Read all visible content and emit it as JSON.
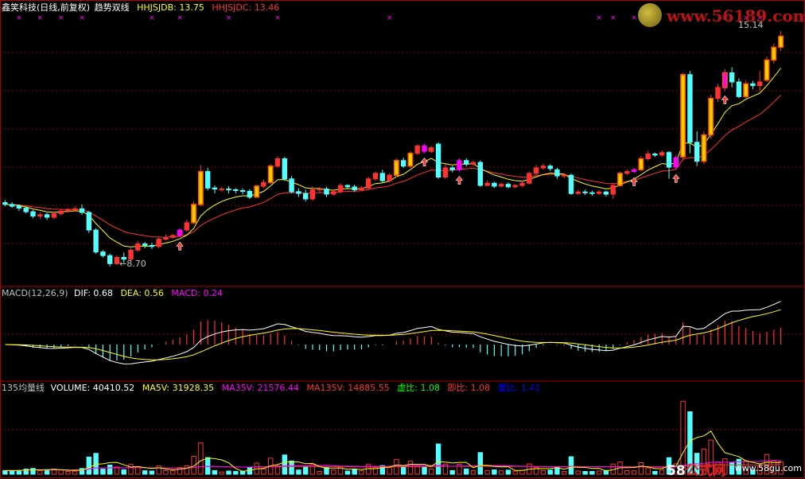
{
  "price_panel": {
    "title": "鑫笑科技(日线,前复权)",
    "indicator": "趋势双线",
    "hhjsjdb_label": "HHJSJDB: 13.75",
    "hhjsjdc_label": "HHJSJDC: 13.46",
    "high_label": "15.14",
    "low_label": "←8.70"
  },
  "macd_panel": {
    "title": "MACD(12,26,9)",
    "dif_label": "DIF: 0.68",
    "dea_label": "DEA: 0.56",
    "macd_label": "MACD: 0.24"
  },
  "volume_panel": {
    "title": "135均量线",
    "volume_label": "VOLUME: 40410.52",
    "ma5v_label": "MA5V: 31928.35",
    "ma35v_label": "MA35V: 21576.44",
    "ma135v_label": "MA135V: 14885.55",
    "xu_label": "虚比: 1.08",
    "ji_label": "即比: 1.08",
    "liang_label": "量比: 1.41"
  },
  "watermarks": {
    "top_site": "www.56189.com",
    "bottom_brand_num": "58",
    "bottom_brand_cn": "公式网",
    "bottom_url": "www.58gu.com"
  },
  "colors": {
    "up": "#ff3232",
    "down": "#54ffff",
    "up_fill": "#000000",
    "buy_mark": "#ff00ff",
    "ma_fast": "#ffff00",
    "ma_slow": "#ff3232",
    "grid": "#8b0000",
    "dif": "#ffffff",
    "dea": "#ffff00",
    "vol_ma5": "#ffff00",
    "vol_ma35": "#ff00ff",
    "vol_ma135": "#ff3232"
  },
  "chart_data": {
    "type": "candlestick",
    "price_range": [
      8.2,
      15.6
    ],
    "candles": [
      [
        10.45,
        10.4,
        10.52,
        10.35
      ],
      [
        10.4,
        10.35,
        10.46,
        10.3
      ],
      [
        10.36,
        10.3,
        10.4,
        10.22
      ],
      [
        10.3,
        10.2,
        10.35,
        10.15
      ],
      [
        10.2,
        10.08,
        10.25,
        10.02
      ],
      [
        10.08,
        10.12,
        10.18,
        10.0
      ],
      [
        10.12,
        10.05,
        10.16,
        9.98
      ],
      [
        10.05,
        10.15,
        10.2,
        10.0
      ],
      [
        10.15,
        10.22,
        10.28,
        10.1
      ],
      [
        10.22,
        10.25,
        10.3,
        10.18
      ],
      [
        10.25,
        10.28,
        10.35,
        10.2
      ],
      [
        10.28,
        10.18,
        10.4,
        10.12
      ],
      [
        10.18,
        9.7,
        10.22,
        9.62
      ],
      [
        9.7,
        9.1,
        9.75,
        9.05
      ],
      [
        9.1,
        9.0,
        9.15,
        8.95
      ],
      [
        9.0,
        8.78,
        9.05,
        8.7
      ],
      [
        8.78,
        8.95,
        9.0,
        8.74
      ],
      [
        8.95,
        8.9,
        9.08,
        8.8
      ],
      [
        8.9,
        9.15,
        9.2,
        8.85
      ],
      [
        9.15,
        9.32,
        9.4,
        9.1
      ],
      [
        9.32,
        9.28,
        9.38,
        9.2
      ],
      [
        9.28,
        9.25,
        9.35,
        9.18
      ],
      [
        9.25,
        9.45,
        9.5,
        9.2
      ],
      [
        9.45,
        9.5,
        9.58,
        9.42
      ],
      [
        9.5,
        9.55,
        9.6,
        9.46
      ],
      [
        9.55,
        9.7,
        9.75,
        9.5
      ],
      [
        9.7,
        9.9,
        9.98,
        9.66
      ],
      [
        9.9,
        10.4,
        10.48,
        9.85
      ],
      [
        10.4,
        11.3,
        11.48,
        10.35
      ],
      [
        11.3,
        10.85,
        11.4,
        10.78
      ],
      [
        10.85,
        10.82,
        10.92,
        10.7
      ],
      [
        10.82,
        10.82,
        10.88,
        10.75
      ],
      [
        10.82,
        10.8,
        10.9,
        10.7
      ],
      [
        10.8,
        10.78,
        10.85,
        10.7
      ],
      [
        10.78,
        10.76,
        10.84,
        10.68
      ],
      [
        10.76,
        10.6,
        10.82,
        10.55
      ],
      [
        10.6,
        10.9,
        10.95,
        10.58
      ],
      [
        10.9,
        11.0,
        11.08,
        10.85
      ],
      [
        11.0,
        11.45,
        11.5,
        10.96
      ],
      [
        11.45,
        11.65,
        11.72,
        11.4
      ],
      [
        11.65,
        11.1,
        11.7,
        11.05
      ],
      [
        11.1,
        10.75,
        11.18,
        10.7
      ],
      [
        10.75,
        10.7,
        10.84,
        10.6
      ],
      [
        10.7,
        10.55,
        10.8,
        10.48
      ],
      [
        10.55,
        10.8,
        10.9,
        10.5
      ],
      [
        10.8,
        10.82,
        10.88,
        10.74
      ],
      [
        10.82,
        10.68,
        10.88,
        10.6
      ],
      [
        10.68,
        10.75,
        10.82,
        10.64
      ],
      [
        10.75,
        10.92,
        10.98,
        10.7
      ],
      [
        10.92,
        10.88,
        10.95,
        10.82
      ],
      [
        10.88,
        10.8,
        10.94,
        10.74
      ],
      [
        10.8,
        10.85,
        10.9,
        10.76
      ],
      [
        10.85,
        11.1,
        11.15,
        10.8
      ],
      [
        11.1,
        11.25,
        11.3,
        11.05
      ],
      [
        11.25,
        11.05,
        11.35,
        11.0
      ],
      [
        11.05,
        11.2,
        11.25,
        11.0
      ],
      [
        11.2,
        11.6,
        11.66,
        11.15
      ],
      [
        11.6,
        11.45,
        11.68,
        11.4
      ],
      [
        11.45,
        11.8,
        11.85,
        11.4
      ],
      [
        11.8,
        12.0,
        12.05,
        11.75
      ],
      [
        12.0,
        11.85,
        12.06,
        11.8
      ],
      [
        11.85,
        11.95,
        12.0,
        11.8
      ],
      [
        12.05,
        11.15,
        12.1,
        11.1
      ],
      [
        11.15,
        11.4,
        11.5,
        11.1
      ],
      [
        11.4,
        11.35,
        11.45,
        11.28
      ],
      [
        11.35,
        11.6,
        11.66,
        11.3
      ],
      [
        11.6,
        11.5,
        11.66,
        11.44
      ],
      [
        11.5,
        11.55,
        11.6,
        11.45
      ],
      [
        11.55,
        10.92,
        11.6,
        10.88
      ],
      [
        10.92,
        10.98,
        11.05,
        10.9
      ],
      [
        10.98,
        10.9,
        11.02,
        10.85
      ],
      [
        10.9,
        10.95,
        11.0,
        10.86
      ],
      [
        10.95,
        10.88,
        11.0,
        10.84
      ],
      [
        10.88,
        10.92,
        10.96,
        10.84
      ],
      [
        10.92,
        10.98,
        11.05,
        10.88
      ],
      [
        10.98,
        11.25,
        11.3,
        10.95
      ],
      [
        11.25,
        11.4,
        11.48,
        11.2
      ],
      [
        11.4,
        11.45,
        11.52,
        11.35
      ],
      [
        11.45,
        11.38,
        11.5,
        11.32
      ],
      [
        11.35,
        11.18,
        11.4,
        11.1
      ],
      [
        11.18,
        11.2,
        11.25,
        11.12
      ],
      [
        11.2,
        10.7,
        11.24,
        10.66
      ],
      [
        10.7,
        10.74,
        10.8,
        10.66
      ],
      [
        10.74,
        10.72,
        10.8,
        10.66
      ],
      [
        10.72,
        10.7,
        10.78,
        10.64
      ],
      [
        10.7,
        10.74,
        10.8,
        10.66
      ],
      [
        10.74,
        10.68,
        10.78,
        10.62
      ],
      [
        10.68,
        10.92,
        10.98,
        10.55
      ],
      [
        10.92,
        11.25,
        11.3,
        10.88
      ],
      [
        11.25,
        11.3,
        11.36,
        11.2
      ],
      [
        11.3,
        11.35,
        11.4,
        11.26
      ],
      [
        11.35,
        11.65,
        11.72,
        11.3
      ],
      [
        11.65,
        11.78,
        11.86,
        11.6
      ],
      [
        11.78,
        11.75,
        11.82,
        11.7
      ],
      [
        11.75,
        11.82,
        11.88,
        11.7
      ],
      [
        11.82,
        11.42,
        11.86,
        11.1
      ],
      [
        11.42,
        11.68,
        11.75,
        11.35
      ],
      [
        11.7,
        13.95,
        14.0,
        11.6
      ],
      [
        13.95,
        12.1,
        14.05,
        11.8
      ],
      [
        12.1,
        11.58,
        12.4,
        11.45
      ],
      [
        11.58,
        12.3,
        12.4,
        11.5
      ],
      [
        12.3,
        13.3,
        13.4,
        12.2
      ],
      [
        13.3,
        13.6,
        13.7,
        13.2
      ],
      [
        13.6,
        14.0,
        14.1,
        13.5
      ],
      [
        14.0,
        13.75,
        14.15,
        13.6
      ],
      [
        13.75,
        13.35,
        13.85,
        13.3
      ],
      [
        13.35,
        13.7,
        13.8,
        13.3
      ],
      [
        13.7,
        13.65,
        13.78,
        13.55
      ],
      [
        13.65,
        13.75,
        14.05,
        13.5
      ],
      [
        13.8,
        14.35,
        14.45,
        13.75
      ],
      [
        14.35,
        14.7,
        14.8,
        14.25
      ],
      [
        14.7,
        15.0,
        15.14,
        14.6
      ]
    ],
    "buy_signal_indices": [
      25,
      60,
      65,
      90,
      96,
      103
    ],
    "buy_candle_indices": [
      25,
      60,
      65,
      90,
      96,
      103
    ],
    "top_markers": [
      2,
      5,
      8,
      11,
      21,
      25,
      32,
      39,
      55,
      85,
      87,
      90,
      103,
      106,
      108,
      114
    ]
  }
}
